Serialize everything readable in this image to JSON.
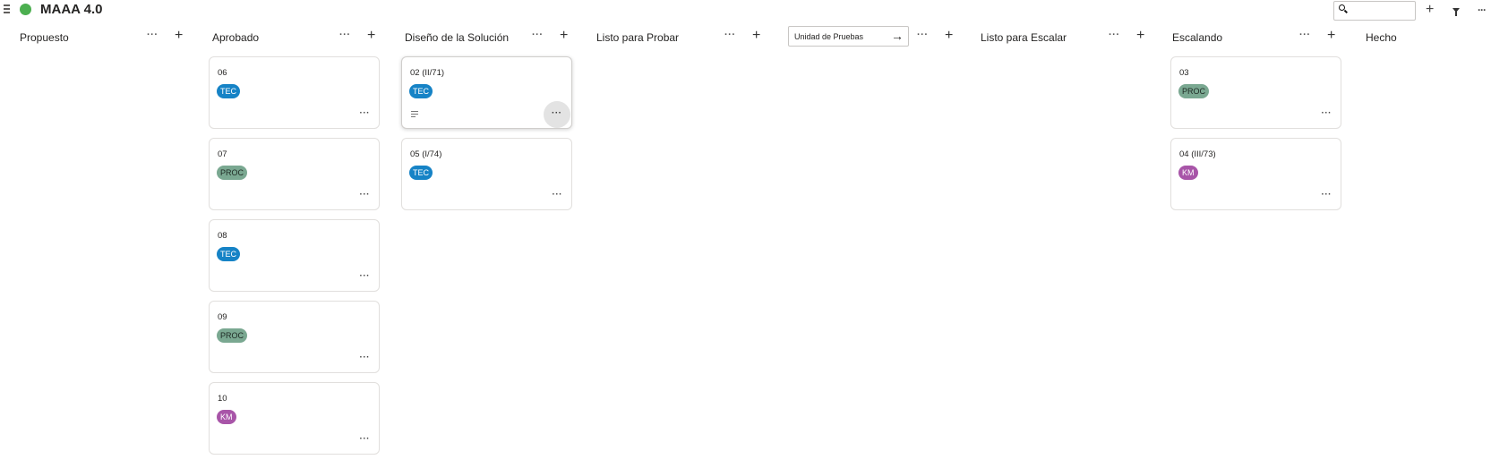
{
  "board": {
    "title": "MAAA 4.0",
    "status_color": "#4caf50"
  },
  "toolbar": {
    "search_placeholder": "",
    "add_label": "+",
    "more_label": "···"
  },
  "columns": [
    {
      "title": "Propuesto"
    },
    {
      "title": "Aprobado"
    },
    {
      "title": "Diseño de la Solución"
    },
    {
      "title": "Listo para Probar"
    },
    {
      "title": "",
      "editing_value": "Unidad de Pruebas"
    },
    {
      "title": "Listo para Escalar"
    },
    {
      "title": "Escalando"
    },
    {
      "title": "Hecho"
    }
  ],
  "column_controls": {
    "more": "···",
    "add": "+"
  },
  "cards": {
    "aprobado": [
      {
        "title": "06",
        "tag": "TEC"
      },
      {
        "title": "07",
        "tag": "PROC"
      },
      {
        "title": "08",
        "tag": "TEC"
      },
      {
        "title": "09",
        "tag": "PROC"
      },
      {
        "title": "10",
        "tag": "KM"
      }
    ],
    "diseno": [
      {
        "title": "02 (II/71)",
        "tag": "TEC"
      },
      {
        "title": "05 (I/74)",
        "tag": "TEC"
      }
    ],
    "escalando": [
      {
        "title": "03",
        "tag": "PROC"
      },
      {
        "title": "04 (III/73)",
        "tag": "KM"
      }
    ]
  },
  "card_more_label": "···",
  "tag_colors": {
    "TEC": "#1683c6",
    "PROC": "#7aa891",
    "KM": "#a855a8"
  }
}
